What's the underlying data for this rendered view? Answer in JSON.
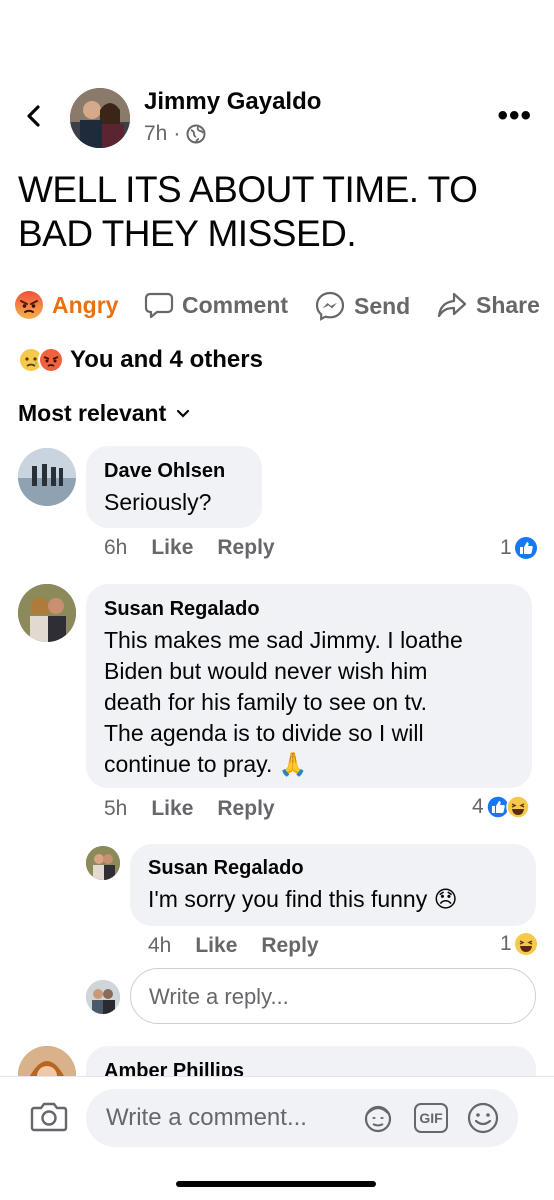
{
  "post": {
    "author": "Jimmy Gayaldo",
    "time": "7h",
    "dot": "·",
    "text_line1": "WELL ITS ABOUT TIME. TO",
    "text_line2": "BAD THEY MISSED."
  },
  "actions": {
    "angry": "Angry",
    "comment": "Comment",
    "send": "Send",
    "share": "Share"
  },
  "reactions_summary": "You and 4 others",
  "sort_label": "Most relevant",
  "comments": [
    {
      "name": "Dave Ohlsen",
      "text": "Seriously?",
      "time": "6h",
      "like": "Like",
      "reply": "Reply",
      "count": "1"
    },
    {
      "name": "Susan Regalado",
      "lines": [
        "This makes me sad Jimmy. I loathe",
        "Biden but would never wish him",
        "death for his family to see on tv.",
        "The agenda is to divide so I will",
        "continue to pray. 🙏"
      ],
      "time": "5h",
      "like": "Like",
      "reply": "Reply",
      "count": "4"
    },
    {
      "name": "Susan Regalado",
      "text": "I'm sorry you find this funny 😞",
      "time": "4h",
      "like": "Like",
      "reply": "Reply",
      "count": "1"
    },
    {
      "name": "Amber Phillips"
    }
  ],
  "reply_placeholder": "Write a reply...",
  "comment_placeholder": "Write a comment...",
  "gif_label": "GIF",
  "colors": {
    "angry": "#e9710f",
    "like_blue": "#1877f2",
    "bubble": "#f0f2f5",
    "meta_gray": "#65676b"
  }
}
